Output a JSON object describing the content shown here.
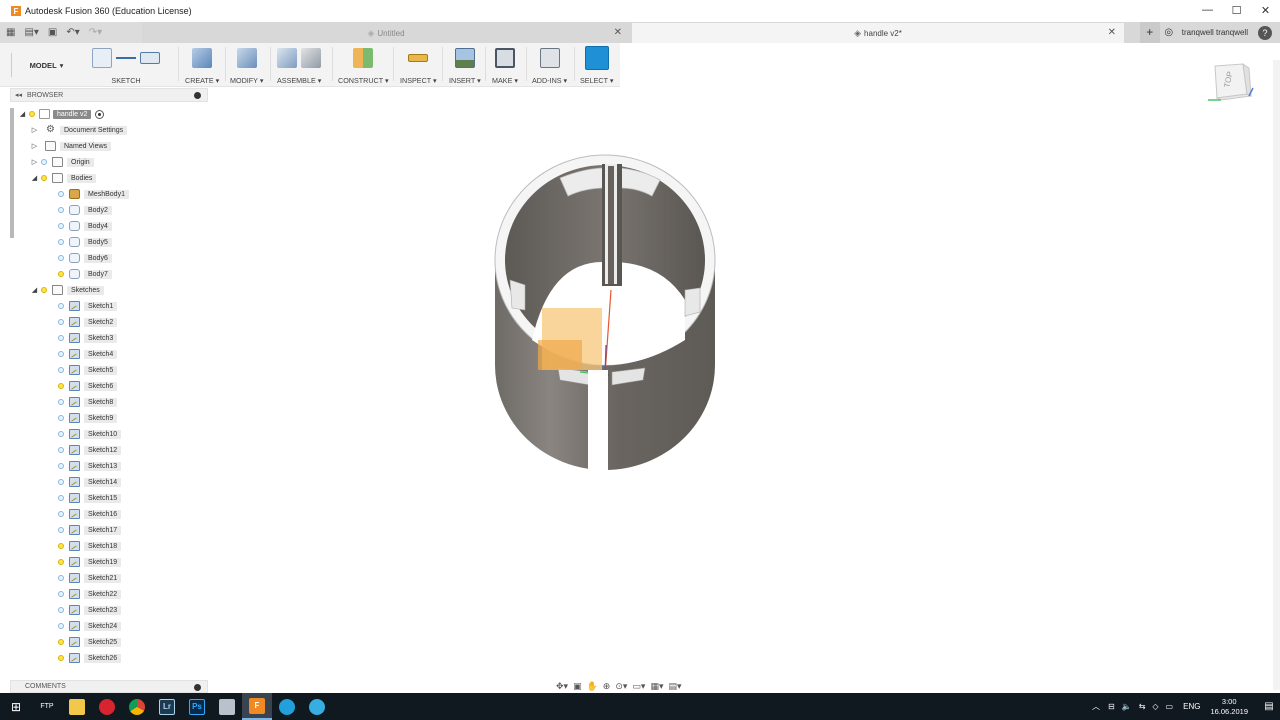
{
  "window": {
    "title": "Autodesk Fusion 360 (Education License)",
    "minimize": "—",
    "maximize": "☐",
    "close": "✕"
  },
  "tabs": [
    {
      "label": "Untitled",
      "active": false
    },
    {
      "label": "handle v2*",
      "active": true
    }
  ],
  "user": {
    "name": "tranqwell tranqwell",
    "help": "?"
  },
  "workspace": "MODEL",
  "toolbar": [
    {
      "label": "SKETCH"
    },
    {
      "label": "CREATE"
    },
    {
      "label": "MODIFY"
    },
    {
      "label": "ASSEMBLE"
    },
    {
      "label": "CONSTRUCT"
    },
    {
      "label": "INSPECT"
    },
    {
      "label": "INSERT"
    },
    {
      "label": "MAKE"
    },
    {
      "label": "ADD-INS"
    },
    {
      "label": "SELECT"
    }
  ],
  "browser": {
    "title": "BROWSER",
    "root": "handle v2",
    "items": [
      {
        "label": "Document Settings"
      },
      {
        "label": "Named Views"
      },
      {
        "label": "Origin"
      },
      {
        "label": "Bodies"
      }
    ],
    "bodies": [
      "MeshBody1",
      "Body2",
      "Body4",
      "Body5",
      "Body6",
      "Body7"
    ],
    "sketches_label": "Sketches",
    "sketches": [
      "Sketch1",
      "Sketch2",
      "Sketch3",
      "Sketch4",
      "Sketch5",
      "Sketch6",
      "Sketch8",
      "Sketch9",
      "Sketch10",
      "Sketch12",
      "Sketch13",
      "Sketch14",
      "Sketch15",
      "Sketch16",
      "Sketch17",
      "Sketch18",
      "Sketch19",
      "Sketch21",
      "Sketch22",
      "Sketch23",
      "Sketch24",
      "Sketch25",
      "Sketch26"
    ]
  },
  "comments": {
    "label": "COMMENTS"
  },
  "viewcube": {
    "face": "TOP"
  },
  "taskbar": {
    "apps": [
      "FTP",
      "Lr",
      "Ps",
      "F"
    ],
    "language": "ENG",
    "time": "3:00",
    "date": "16.06.2019"
  }
}
